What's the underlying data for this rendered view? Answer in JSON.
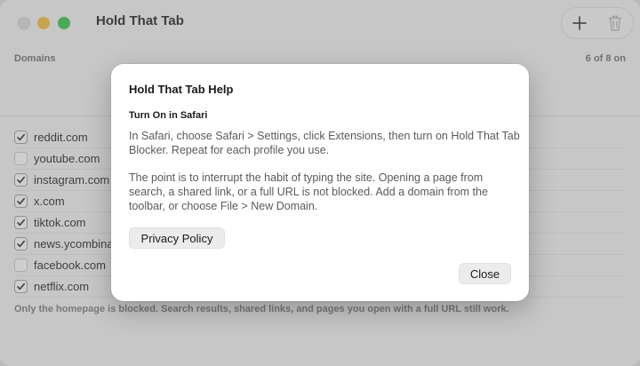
{
  "window": {
    "title": "Hold That Tab"
  },
  "toolbar": {
    "add_icon": "plus-icon",
    "trash_icon": "trash-icon"
  },
  "domains": {
    "header": "Domains",
    "count": "6 of 8 on",
    "items": [
      {
        "label": "reddit.com",
        "checked": true
      },
      {
        "label": "youtube.com",
        "checked": false
      },
      {
        "label": "instagram.com",
        "checked": true
      },
      {
        "label": "x.com",
        "checked": true
      },
      {
        "label": "tiktok.com",
        "checked": true
      },
      {
        "label": "news.ycombinator.com",
        "checked": true
      },
      {
        "label": "facebook.com",
        "checked": false
      },
      {
        "label": "netflix.com",
        "checked": true
      }
    ],
    "footer": "Only the homepage is blocked. Search results, shared links, and pages you open with a full URL still work."
  },
  "dialog": {
    "title": "Hold That Tab Help",
    "section": "Turn On in Safari",
    "paragraph1": "In Safari, choose Safari > Settings, click Extensions, then turn on Hold That Tab Blocker. Repeat for each profile you use.",
    "paragraph2": "The point is to interrupt the habit of typing the site. Opening a page from search, a shared link, or a full URL is not blocked. Add a domain from the toolbar, or choose File > New Domain.",
    "privacy_label": "Privacy Policy",
    "close_label": "Close"
  },
  "colors": {
    "traffic_close": "#dcdcdc",
    "traffic_min": "#f5bc2f",
    "traffic_max": "#2fc845"
  }
}
